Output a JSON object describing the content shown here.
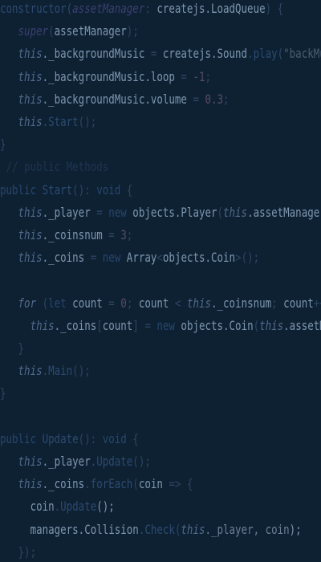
{
  "editor": {
    "language": "typescript",
    "colors": {
      "background": "#0e2133",
      "identifier": "#7d96ad",
      "keyword": "#27466c",
      "this": "#4f6a8a",
      "function": "#2c4a70",
      "comment": "#1e3550",
      "number": "#5a4a68",
      "string": "#4a5e70"
    },
    "lines": [
      [
        {
          "t": "constructor(",
          "c": "fn"
        },
        {
          "t": "assetManager",
          "c": "param"
        },
        {
          "t": ": ",
          "c": "punc"
        },
        {
          "t": "createjs.LoadQueue",
          "c": "plain"
        },
        {
          "t": ") {",
          "c": "punc"
        }
      ],
      [
        {
          "t": "   ",
          "c": "plain"
        },
        {
          "t": "super",
          "c": "param"
        },
        {
          "t": "(",
          "c": "punc"
        },
        {
          "t": "assetManager",
          "c": "plain"
        },
        {
          "t": ");",
          "c": "punc"
        }
      ],
      [
        {
          "t": "   ",
          "c": "plain"
        },
        {
          "t": "this",
          "c": "this"
        },
        {
          "t": "._backgroundMusic",
          "c": "plain"
        },
        {
          "t": " = ",
          "c": "punc"
        },
        {
          "t": "createjs.Sound",
          "c": "plain"
        },
        {
          "t": ".play(",
          "c": "fn"
        },
        {
          "t": "\"backMusic\"",
          "c": "str"
        }
      ],
      [
        {
          "t": "   ",
          "c": "plain"
        },
        {
          "t": "this",
          "c": "this"
        },
        {
          "t": "._backgroundMusic.loop",
          "c": "plain"
        },
        {
          "t": " = ",
          "c": "punc"
        },
        {
          "t": "-1",
          "c": "num"
        },
        {
          "t": ";",
          "c": "punc"
        }
      ],
      [
        {
          "t": "   ",
          "c": "plain"
        },
        {
          "t": "this",
          "c": "this"
        },
        {
          "t": "._backgroundMusic.volume",
          "c": "plain"
        },
        {
          "t": " = ",
          "c": "punc"
        },
        {
          "t": "0.3",
          "c": "num"
        },
        {
          "t": ";",
          "c": "punc"
        }
      ],
      [
        {
          "t": "   ",
          "c": "plain"
        },
        {
          "t": "this",
          "c": "this"
        },
        {
          "t": ".Start",
          "c": "fn"
        },
        {
          "t": "();",
          "c": "punc"
        }
      ],
      [
        {
          "t": "}",
          "c": "punc"
        }
      ],
      [
        {
          "t": " // public Methods",
          "c": "cm"
        }
      ],
      [
        {
          "t": "public ",
          "c": "kw"
        },
        {
          "t": "Start",
          "c": "fn"
        },
        {
          "t": "(): ",
          "c": "punc"
        },
        {
          "t": "void",
          "c": "kw"
        },
        {
          "t": " {",
          "c": "punc"
        }
      ],
      [
        {
          "t": "   ",
          "c": "plain"
        },
        {
          "t": "this",
          "c": "this"
        },
        {
          "t": "._player",
          "c": "plain"
        },
        {
          "t": " = ",
          "c": "punc"
        },
        {
          "t": "new ",
          "c": "kw"
        },
        {
          "t": "objects.Player",
          "c": "plain"
        },
        {
          "t": "(",
          "c": "punc"
        },
        {
          "t": "this",
          "c": "this"
        },
        {
          "t": ".assetManager",
          "c": "plain"
        },
        {
          "t": ");",
          "c": "punc"
        }
      ],
      [
        {
          "t": "   ",
          "c": "plain"
        },
        {
          "t": "this",
          "c": "this"
        },
        {
          "t": "._coinsnum",
          "c": "plain"
        },
        {
          "t": " = ",
          "c": "punc"
        },
        {
          "t": "3",
          "c": "num"
        },
        {
          "t": ";",
          "c": "punc"
        }
      ],
      [
        {
          "t": "   ",
          "c": "plain"
        },
        {
          "t": "this",
          "c": "this"
        },
        {
          "t": "._coins",
          "c": "plain"
        },
        {
          "t": " = ",
          "c": "punc"
        },
        {
          "t": "new ",
          "c": "kw"
        },
        {
          "t": "Array",
          "c": "plain"
        },
        {
          "t": "<",
          "c": "punc"
        },
        {
          "t": "objects.Coin",
          "c": "plain"
        },
        {
          "t": ">();",
          "c": "punc"
        }
      ],
      [
        {
          "t": "",
          "c": "plain"
        }
      ],
      [
        {
          "t": "   ",
          "c": "plain"
        },
        {
          "t": "for",
          "c": "this"
        },
        {
          "t": " (",
          "c": "punc"
        },
        {
          "t": "let ",
          "c": "kw"
        },
        {
          "t": "count",
          "c": "plain"
        },
        {
          "t": " = ",
          "c": "punc"
        },
        {
          "t": "0",
          "c": "num"
        },
        {
          "t": "; ",
          "c": "punc"
        },
        {
          "t": "count",
          "c": "plain"
        },
        {
          "t": " < ",
          "c": "punc"
        },
        {
          "t": "this",
          "c": "this"
        },
        {
          "t": "._coinsnum",
          "c": "plain"
        },
        {
          "t": "; ",
          "c": "punc"
        },
        {
          "t": "count",
          "c": "plain"
        },
        {
          "t": "++) {",
          "c": "punc"
        }
      ],
      [
        {
          "t": "     ",
          "c": "plain"
        },
        {
          "t": "this",
          "c": "this"
        },
        {
          "t": "._coins",
          "c": "plain"
        },
        {
          "t": "[",
          "c": "punc"
        },
        {
          "t": "count",
          "c": "plain"
        },
        {
          "t": "] = ",
          "c": "punc"
        },
        {
          "t": "new ",
          "c": "kw"
        },
        {
          "t": "objects.Coin",
          "c": "plain"
        },
        {
          "t": "(",
          "c": "punc"
        },
        {
          "t": "this",
          "c": "this"
        },
        {
          "t": ".assetManager",
          "c": "plain"
        },
        {
          "t": ");",
          "c": "punc"
        }
      ],
      [
        {
          "t": "   ",
          "c": "plain"
        },
        {
          "t": "}",
          "c": "punc"
        }
      ],
      [
        {
          "t": "   ",
          "c": "plain"
        },
        {
          "t": "this",
          "c": "this"
        },
        {
          "t": ".Main",
          "c": "fn"
        },
        {
          "t": "();",
          "c": "punc"
        }
      ],
      [
        {
          "t": "}",
          "c": "punc"
        }
      ],
      [
        {
          "t": "",
          "c": "plain"
        }
      ],
      [
        {
          "t": "public ",
          "c": "kw"
        },
        {
          "t": "Update",
          "c": "fn"
        },
        {
          "t": "(): ",
          "c": "punc"
        },
        {
          "t": "void",
          "c": "kw"
        },
        {
          "t": " {",
          "c": "punc"
        }
      ],
      [
        {
          "t": "   ",
          "c": "plain"
        },
        {
          "t": "this",
          "c": "this"
        },
        {
          "t": "._player",
          "c": "plain"
        },
        {
          "t": ".Update",
          "c": "fn"
        },
        {
          "t": "();",
          "c": "punc"
        }
      ],
      [
        {
          "t": "   ",
          "c": "plain"
        },
        {
          "t": "this",
          "c": "this"
        },
        {
          "t": "._coins",
          "c": "plain"
        },
        {
          "t": ".forEach",
          "c": "fn"
        },
        {
          "t": "(",
          "c": "punc"
        },
        {
          "t": "coin",
          "c": "plain"
        },
        {
          "t": " => {",
          "c": "punc"
        }
      ],
      [
        {
          "t": "     ",
          "c": "plain"
        },
        {
          "t": "coin",
          "c": "plain"
        },
        {
          "t": ".Update",
          "c": "fn"
        },
        {
          "t": "();",
          "c": "plain"
        }
      ],
      [
        {
          "t": "     ",
          "c": "plain"
        },
        {
          "t": "managers.Collision",
          "c": "plain"
        },
        {
          "t": ".Check",
          "c": "fn"
        },
        {
          "t": "(",
          "c": "punc"
        },
        {
          "t": "this",
          "c": "this"
        },
        {
          "t": "._player, coin",
          "c": "faded"
        },
        {
          "t": ");",
          "c": "plain"
        }
      ],
      [
        {
          "t": "   ",
          "c": "plain"
        },
        {
          "t": "});",
          "c": "punc"
        }
      ]
    ]
  }
}
